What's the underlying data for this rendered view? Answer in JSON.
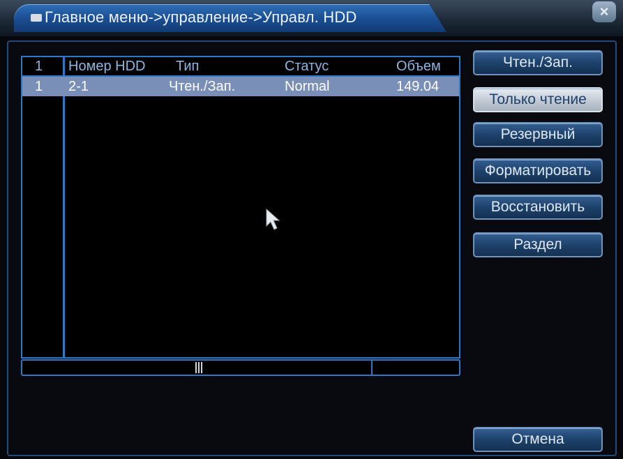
{
  "window": {
    "title": "Главное меню->управление->Управл. HDD",
    "close_label": "×"
  },
  "table": {
    "headers": [
      "1",
      "Номер HDD",
      "Тип",
      "Статус",
      "Объем"
    ],
    "rows": [
      {
        "index": "1",
        "number": "2-1",
        "type": "Чтен./Зап.",
        "status": "Normal",
        "capacity": "149.04"
      }
    ]
  },
  "buttons": {
    "read_write": "Чтен./Зап.",
    "read_only": "Только чтение",
    "redundant": "Резервный",
    "format": "Форматировать",
    "recover": "Восстановить",
    "partition": "Раздел",
    "cancel": "Отмена"
  },
  "colors": {
    "accent": "#2f78c8",
    "selected_row": "#7a8fb8",
    "title_tab": "#2f6fb8"
  },
  "icons": [
    "hdd-icon",
    "close-icon",
    "mouse-cursor-icon"
  ]
}
